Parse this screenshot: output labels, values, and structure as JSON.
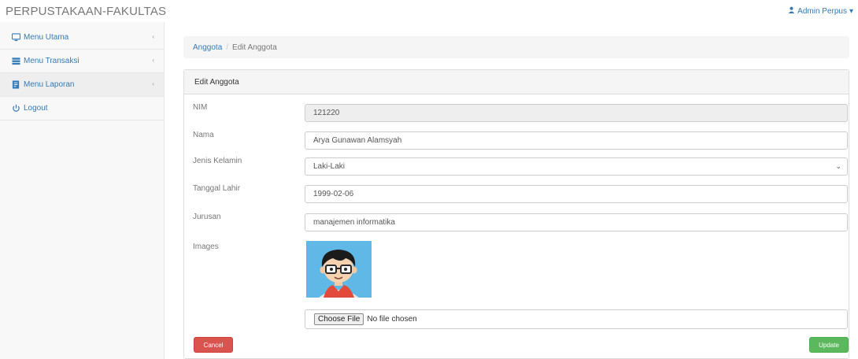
{
  "app": {
    "brand": "PERPUSTAKAAN-FAKULTAS",
    "user_menu": "Admin Perpus",
    "user_caret": "▾"
  },
  "sidebar": {
    "items": [
      {
        "label": "Menu Utama",
        "icon": "desktop-icon",
        "arrow": "‹"
      },
      {
        "label": "Menu Transaksi",
        "icon": "table-icon",
        "arrow": "‹"
      },
      {
        "label": "Menu Laporan",
        "icon": "report-icon",
        "arrow": "‹"
      },
      {
        "label": "Logout",
        "icon": "power-icon"
      }
    ]
  },
  "breadcrumb": {
    "items": [
      "Anggota",
      "Edit Anggota"
    ],
    "separator": "/"
  },
  "panel": {
    "title": "Edit Anggota"
  },
  "form": {
    "nim": {
      "label": "NIM",
      "value": "121220"
    },
    "nama": {
      "label": "Nama",
      "value": "Arya Gunawan Alamsyah"
    },
    "jenis_kelamin": {
      "label": "Jenis Kelamin",
      "value": "Laki-Laki",
      "caret": "⌄"
    },
    "tanggal_lahir": {
      "label": "Tanggal Lahir",
      "value": "1999-02-06"
    },
    "jurusan": {
      "label": "Jurusan",
      "value": "manajemen informatika"
    },
    "images": {
      "label": "Images",
      "file_button": "Choose File",
      "file_status": "No file chosen"
    }
  },
  "actions": {
    "cancel": "Cancel",
    "update": "Update"
  },
  "colors": {
    "link": "#337ab7",
    "danger": "#d9534f",
    "success": "#5cb85c",
    "avatar_bg": "#5fb8e6"
  }
}
